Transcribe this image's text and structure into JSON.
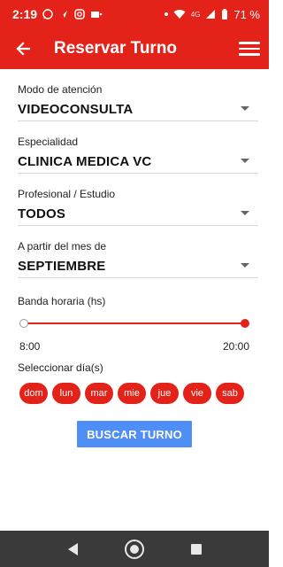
{
  "status_bar": {
    "time": "2:19",
    "network": "4G",
    "battery": "71 %",
    "icons": [
      "whatsapp-icon",
      "navigation-icon",
      "instagram-icon",
      "vpn-icon",
      "wifi-icon",
      "signal-icon",
      "battery-icon"
    ]
  },
  "app_bar": {
    "title": "Reservar Turno",
    "back_icon": "arrow-left-icon",
    "menu_icon": "hamburger-menu-icon"
  },
  "form": {
    "modo": {
      "label": "Modo de atención",
      "value": "VIDEOCONSULTA"
    },
    "especialidad": {
      "label": "Especialidad",
      "value": "CLINICA MEDICA VC"
    },
    "profesional": {
      "label": "Profesional / Estudio",
      "value": "TODOS"
    },
    "mes": {
      "label": "A partir del mes de",
      "value": "SEPTIEMBRE"
    }
  },
  "banda": {
    "label": "Banda horaria (hs)",
    "start": "8:00",
    "end": "20:00"
  },
  "dias": {
    "label": "Seleccionar día(s)",
    "items": [
      "dom",
      "lun",
      "mar",
      "mie",
      "jue",
      "vie",
      "sab"
    ]
  },
  "actions": {
    "buscar": "BUSCAR TURNO"
  },
  "colors": {
    "primary": "#e3231a",
    "button": "#4f8ef7",
    "navbar": "#3a3a3a"
  }
}
